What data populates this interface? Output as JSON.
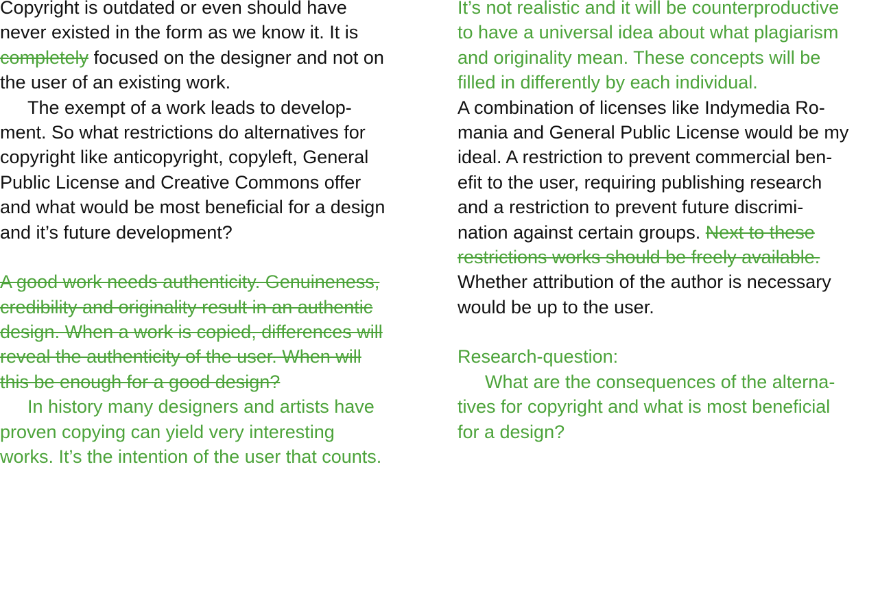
{
  "colors": {
    "text": "#111111",
    "annotation_green": "#4ca33a",
    "background": "#ffffff"
  },
  "left": {
    "p1": {
      "l1": "Copyright is outdated or even should have",
      "l2": "never existed in the form as we know it. It is",
      "l3_struck": "completely",
      "l3_rest": " focused on the designer and not on",
      "l4": "the user of an existing work."
    },
    "p2": {
      "l1": "The exempt of a work leads to develop-",
      "l2": "ment. So what restrictions do alternatives for",
      "l3": "copyright like anticopyright, copyleft, General",
      "l4": "Public License and Creative Commons offer",
      "l5": "and what would be most beneficial for a design",
      "l6": "and it’s future development?"
    },
    "struck_block": {
      "l1": "A good work needs authenticity. Genuineness, ",
      "l2": "credibility and originality result in an authentic ",
      "l3": "design.  When a work is copied, differences will",
      "l4": "reveal the authenticity of the user. When will ",
      "l5": "this be enough for a good design? "
    },
    "p3": {
      "l1": "In history many designers and artists have",
      "l2": "proven copying can yield very interesting",
      "l3": "works. It’s the intention of the user that counts."
    }
  },
  "right": {
    "p1": {
      "l1": "It’s not realistic and it will be counterproductive",
      "l2": "to have a universal idea about what plagiarism",
      "l3": "and originality mean. These concepts will be",
      "l4": "filled in differently by each individual."
    },
    "p2": {
      "l1": "A combination of licenses like Indymedia Ro-",
      "l2": "mania and General Public License would be my",
      "l3": "ideal. A restriction to prevent commercial ben-",
      "l4": "efit to the user, requiring publishing research",
      "l5": "and a restriction to prevent future discrimi-",
      "l6_plain": "nation against certain groups. ",
      "l6_struck": "Next to these ",
      "l7_struck": "restrictions works should be freely available.",
      "l8": "Whether attribution of the author is necessary",
      "l9": "would be up to the user."
    },
    "research": {
      "heading": "Research-question:",
      "l1": "What are the consequences of the alterna-",
      "l2": "tives for copyright and what is most beneficial",
      "l3": "for a design?"
    }
  }
}
